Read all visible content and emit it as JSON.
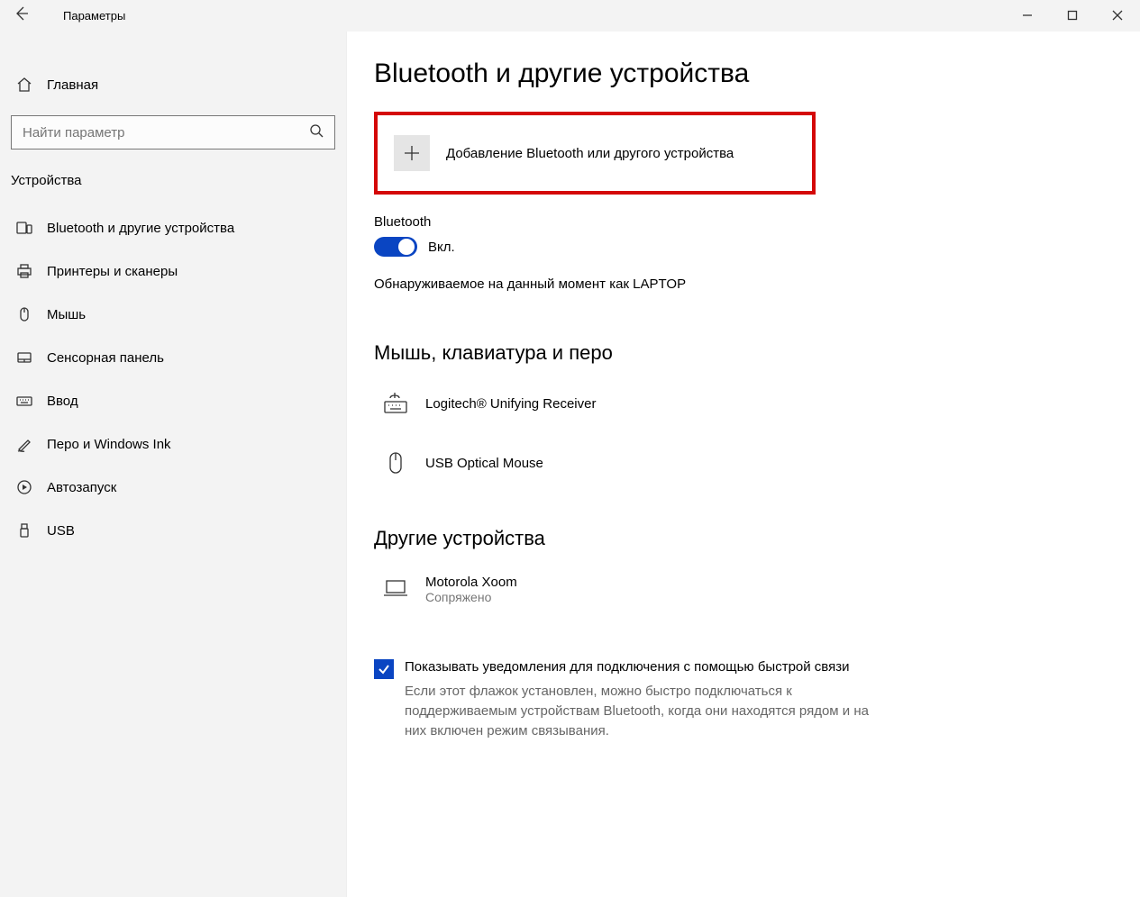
{
  "window": {
    "title": "Параметры"
  },
  "sidebar": {
    "home": "Главная",
    "search_placeholder": "Найти параметр",
    "section": "Устройства",
    "items": [
      {
        "label": "Bluetooth и другие устройства"
      },
      {
        "label": "Принтеры и сканеры"
      },
      {
        "label": "Мышь"
      },
      {
        "label": "Сенсорная панель"
      },
      {
        "label": "Ввод"
      },
      {
        "label": "Перо и Windows Ink"
      },
      {
        "label": "Автозапуск"
      },
      {
        "label": "USB"
      }
    ]
  },
  "page": {
    "title": "Bluetooth и другие устройства",
    "add_device": "Добавление Bluetooth или другого устройства",
    "bt_label": "Bluetooth",
    "bt_state": "Вкл.",
    "discoverable": "Обнаруживаемое на данный момент как  LAPTOP",
    "group1": "Мышь, клавиатура и перо",
    "devices1": [
      {
        "name": "Logitech® Unifying Receiver"
      },
      {
        "name": "USB Optical Mouse"
      }
    ],
    "group2": "Другие устройства",
    "devices2": [
      {
        "name": "Motorola Xoom",
        "status": "Сопряжено"
      }
    ],
    "quickpair_label": "Показывать уведомления для подключения с помощью быстрой связи",
    "quickpair_desc": "Если этот флажок установлен, можно быстро подключаться к поддерживаемым устройствам Bluetooth, когда они находятся рядом и на них включен режим связывания."
  }
}
